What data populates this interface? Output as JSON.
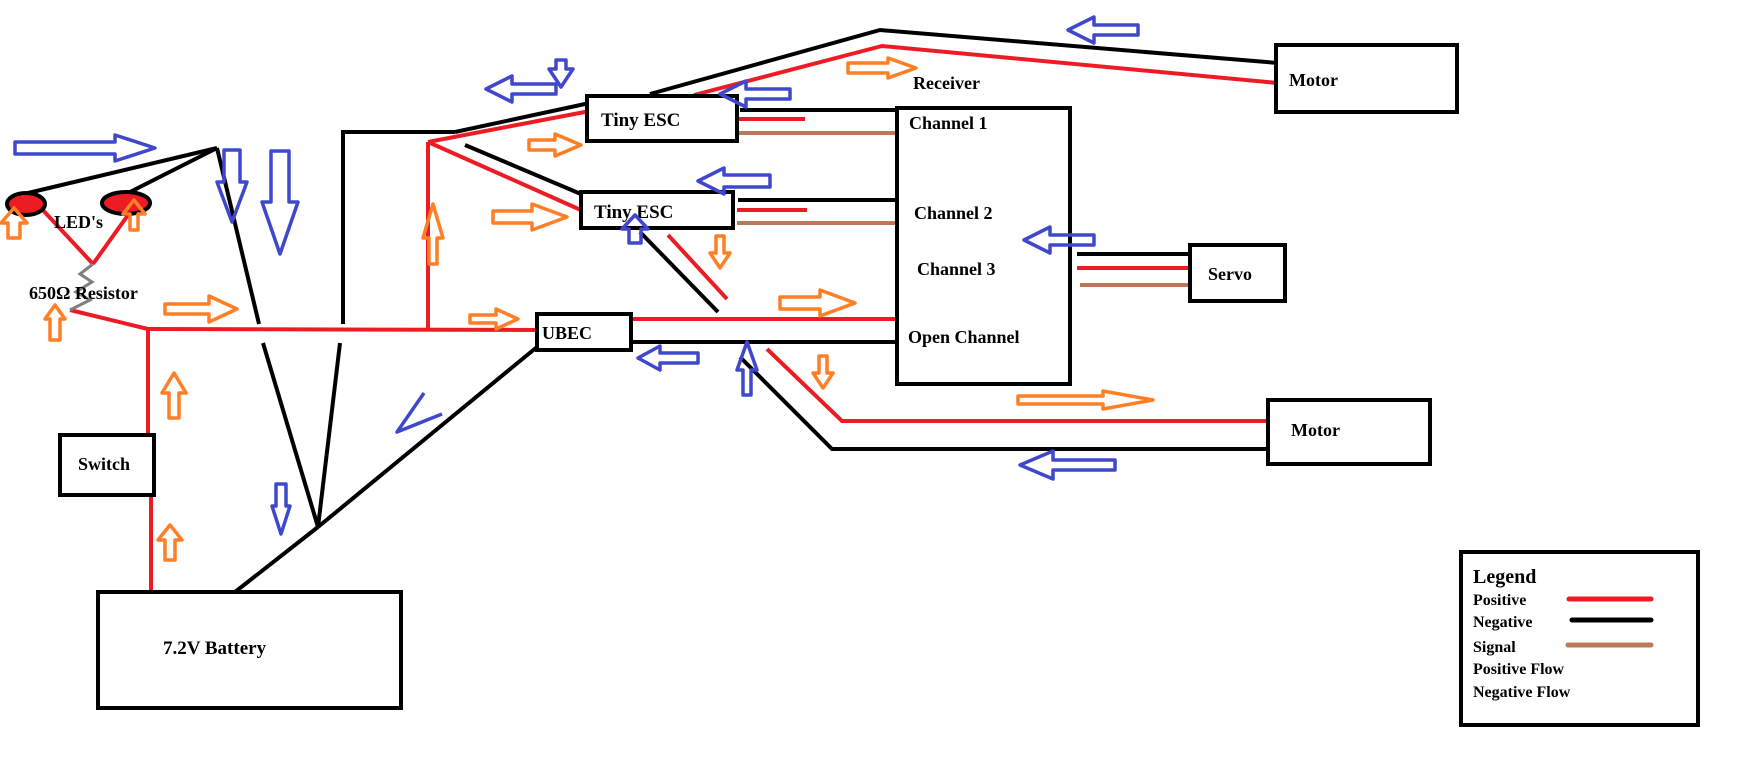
{
  "components": {
    "leds": "LED's",
    "resistor": "650Ω Resistor",
    "switch": "Switch",
    "battery": "7.2V Battery",
    "ubec": "UBEC",
    "esc_1": "Tiny ESC",
    "esc_2": "Tiny ESC",
    "receiver": "Receiver",
    "channel_1": "Channel 1",
    "channel_2": "Channel 2",
    "channel_3": "Channel 3",
    "open_channel": "Open Channel",
    "servo": "Servo",
    "motor_top": "Motor",
    "motor_bottom": "Motor"
  },
  "legend": {
    "title": "Legend",
    "items": [
      {
        "label": "Positive",
        "kind": "line",
        "color": "#ed1c24"
      },
      {
        "label": "Negative",
        "kind": "line",
        "color": "#000000"
      },
      {
        "label": "Signal",
        "kind": "line",
        "color": "#b97a57"
      },
      {
        "label": "Positive Flow",
        "kind": "arrow-right",
        "color": "#ff7f27"
      },
      {
        "label": "Negative Flow",
        "kind": "arrow-left",
        "color": "#3f48cc"
      }
    ]
  },
  "colors": {
    "positive": "#ed1c24",
    "negative": "#000000",
    "signal": "#b97a57",
    "positive_flow": "#ff7f27",
    "negative_flow": "#3f48cc",
    "resistor": "#7f7f7f"
  }
}
